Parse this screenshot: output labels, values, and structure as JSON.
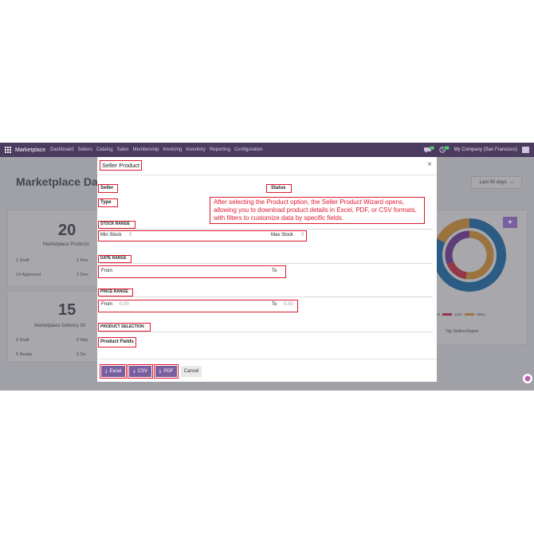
{
  "navbar": {
    "brand": "Marketplace",
    "menu": [
      "Dashboard",
      "Sellers",
      "Catalog",
      "Sales",
      "Membership",
      "Invoicing",
      "Inventory",
      "Reporting",
      "Configuration"
    ],
    "company": "My Company (San Francisco)",
    "badge_msg": "16",
    "badge_act": "13"
  },
  "background": {
    "page_title": "Marketplace Dash",
    "filter_label": "Last 90 days",
    "card1": {
      "number": "20",
      "label": "Marketplace Products",
      "stats": [
        "1 Draft",
        "1 Pen",
        "14 Approved",
        "2 Den"
      ]
    },
    "card2": {
      "number": "15",
      "label": "Marketplace Delivery Or",
      "stats": [
        "0 Draft",
        "0 Wai",
        "6 Ready",
        "9 Do"
      ]
    },
    "chart_legend": [
      "ames",
      "John",
      "Hilary"
    ],
    "chart_caption": "Top Sellers Report",
    "plus_label": "+"
  },
  "modal": {
    "title": "Seller Product",
    "close": "×",
    "seller_label": "Seller",
    "status_label": "Status",
    "type_label": "Type",
    "note": "After selecting the Product option, the Seller Product Wizard opens, allowing you to download product details in Excel, PDF, or CSV formats, with filters to customize data by specific fields.",
    "stock": {
      "title": "STOCK RANGE",
      "min_label": "Min Stock",
      "min_value": "0",
      "max_label": "Max Stock",
      "max_value": "0"
    },
    "date": {
      "title": "DATE RANGE",
      "from_label": "From",
      "to_label": "To"
    },
    "price": {
      "title": "PRICE RANGE",
      "from_label": "From",
      "from_value": "0.00",
      "to_label": "To",
      "to_value": "0.00"
    },
    "product": {
      "title": "PRODUCT SELECTION",
      "fields_label": "Product Fields"
    },
    "buttons": {
      "excel": "Excel",
      "csv": "CSV",
      "pdf": "PDF",
      "cancel": "Cancel"
    }
  },
  "colors": {
    "navbar": "#4b3b5e",
    "primary": "#7a5fa0",
    "annotation": "#e0182c"
  }
}
